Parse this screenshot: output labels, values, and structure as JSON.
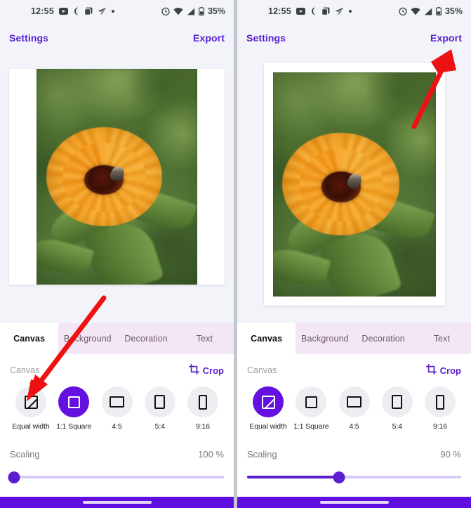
{
  "app": {
    "accent_purple": "#5b1ed0",
    "selected_purple": "#6410e0",
    "nav_purple": "#5f10e0",
    "arrow_color": "#ee1111",
    "screen_bg": "#f2f4f9",
    "panel_bg": "#ffffff",
    "tabbar_bg": "#f3e6f5"
  },
  "status_bar": {
    "time": "12:55",
    "battery": "35%",
    "icons": [
      "youtube-icon",
      "crescent-moon-icon",
      "copy-icon",
      "telegram-icon",
      "small-dot-icon"
    ],
    "right_icons": [
      "alarm-icon",
      "wifi-icon",
      "signal-icon",
      "battery-icon"
    ]
  },
  "app_bar": {
    "settings_label": "Settings",
    "export_label": "Export"
  },
  "tabs": [
    {
      "label": "Canvas",
      "active": true
    },
    {
      "label": "Background",
      "active": false
    },
    {
      "label": "Decoration",
      "active": false
    },
    {
      "label": "Text",
      "active": false
    }
  ],
  "panel": {
    "section_title": "Canvas",
    "crop_label": "Crop",
    "crop_icon": "crop-icon"
  },
  "ratios": [
    {
      "label": "Equal width",
      "icon": "equal-width-icon"
    },
    {
      "label": "1:1 Square",
      "icon": "square-ratio-icon"
    },
    {
      "label": "4:5",
      "icon": "landscape-ratio-icon"
    },
    {
      "label": "5:4",
      "icon": "portrait-ratio-icon"
    },
    {
      "label": "9:16",
      "icon": "tall-portrait-ratio-icon"
    }
  ],
  "left_screen": {
    "selected_ratio_index": 1,
    "scaling_label": "Scaling",
    "scaling_value": "100 %",
    "scaling_percent": 2
  },
  "right_screen": {
    "selected_ratio_index": 0,
    "scaling_label": "Scaling",
    "scaling_value": "90 %",
    "scaling_percent": 43
  },
  "annotations": [
    {
      "name": "arrow-to-equal-width",
      "target": "Equal width option"
    },
    {
      "name": "arrow-to-export",
      "target": "Export button"
    }
  ],
  "photo": {
    "subject": "orange calendula flower with bee on green foliage"
  }
}
